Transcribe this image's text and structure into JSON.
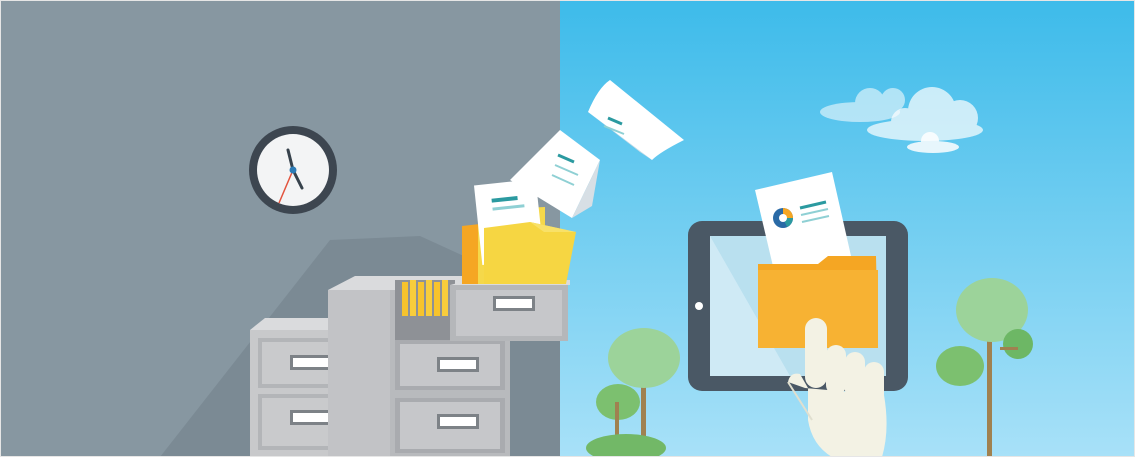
{
  "scene": {
    "left_panel_color": "#8797a1",
    "right_panel_color": "#7fd0f2",
    "folder_color": "#f4d440",
    "folder_orange_color": "#f5a623",
    "cabinet_color": "#c8c9cb",
    "icons": [
      "wall-clock-icon",
      "filing-cabinet-icon",
      "paper-document-icon",
      "folder-icon",
      "tablet-icon",
      "pointing-hand-icon",
      "cloud-icon",
      "tree-icon",
      "pie-chart-icon"
    ]
  }
}
